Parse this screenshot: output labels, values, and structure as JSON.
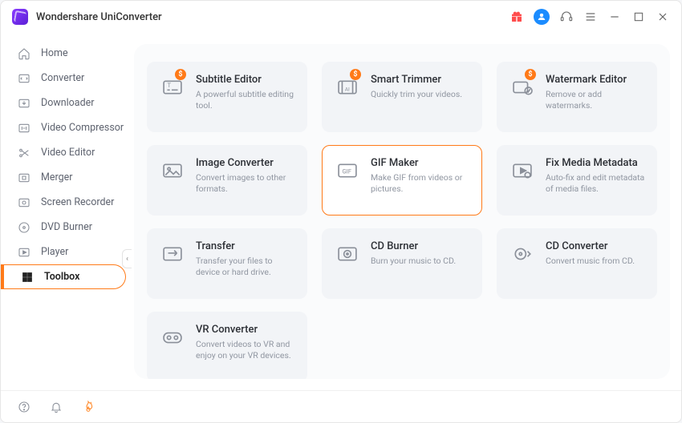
{
  "app": {
    "name": "Wondershare UniConverter"
  },
  "titlebar_icons": [
    "gift",
    "avatar",
    "headset",
    "menu",
    "minimize",
    "maximize",
    "close"
  ],
  "sidebar": {
    "items": [
      {
        "label": "Home",
        "icon": "home"
      },
      {
        "label": "Converter",
        "icon": "converter"
      },
      {
        "label": "Downloader",
        "icon": "download"
      },
      {
        "label": "Video Compressor",
        "icon": "compress"
      },
      {
        "label": "Video Editor",
        "icon": "scissors"
      },
      {
        "label": "Merger",
        "icon": "merge"
      },
      {
        "label": "Screen Recorder",
        "icon": "record"
      },
      {
        "label": "DVD Burner",
        "icon": "disc"
      },
      {
        "label": "Player",
        "icon": "play"
      },
      {
        "label": "Toolbox",
        "icon": "grid",
        "active": true
      }
    ]
  },
  "bottom_icons": [
    "help",
    "bell",
    "fire"
  ],
  "tools": [
    {
      "key": "subtitle",
      "title": "Subtitle Editor",
      "desc": "A powerful subtitle editing tool.",
      "badge": "$"
    },
    {
      "key": "smarttrim",
      "title": "Smart Trimmer",
      "desc": "Quickly trim your videos.",
      "badge": "$"
    },
    {
      "key": "watermark",
      "title": "Watermark Editor",
      "desc": "Remove or add watermarks.",
      "badge": "$"
    },
    {
      "key": "imgconv",
      "title": "Image Converter",
      "desc": "Convert images to other formats."
    },
    {
      "key": "gif",
      "title": "GIF Maker",
      "desc": "Make GIF from videos or pictures.",
      "selected": true
    },
    {
      "key": "fixmeta",
      "title": "Fix Media Metadata",
      "desc": "Auto-fix and edit metadata of media files."
    },
    {
      "key": "transfer",
      "title": "Transfer",
      "desc": "Transfer your files to device or hard drive."
    },
    {
      "key": "cdburn",
      "title": "CD Burner",
      "desc": "Burn your music to CD."
    },
    {
      "key": "cdconv",
      "title": "CD Converter",
      "desc": "Convert music from CD."
    },
    {
      "key": "vr",
      "title": "VR Converter",
      "desc": "Convert videos to VR and enjoy on your VR devices."
    }
  ]
}
